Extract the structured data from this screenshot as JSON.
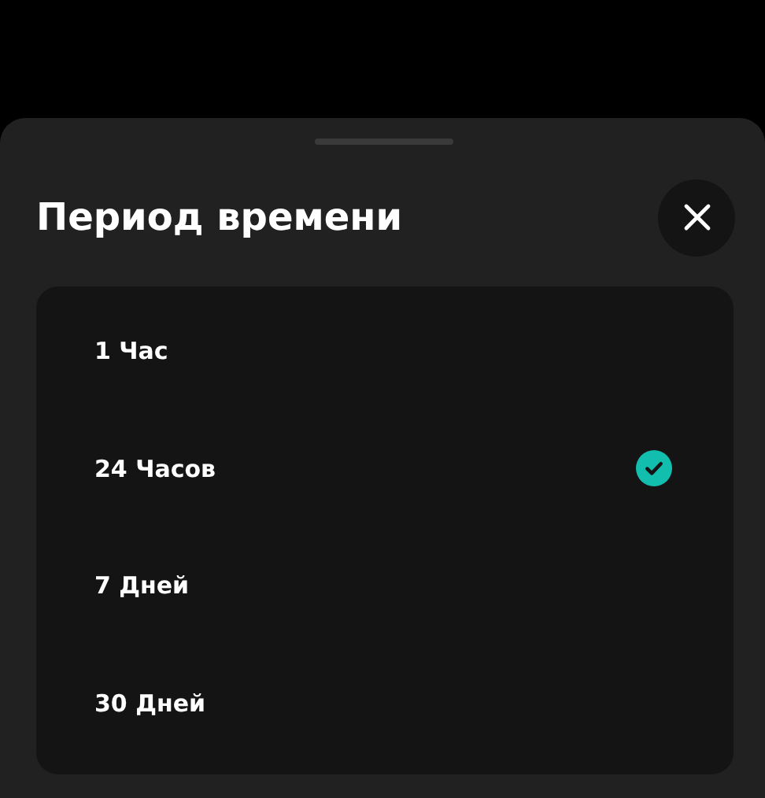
{
  "sheet": {
    "title": "Период времени"
  },
  "options": [
    {
      "label": "1 Час",
      "selected": false
    },
    {
      "label": "24 Часов",
      "selected": true
    },
    {
      "label": "7 Дней",
      "selected": false
    },
    {
      "label": "30 Дней",
      "selected": false
    }
  ]
}
